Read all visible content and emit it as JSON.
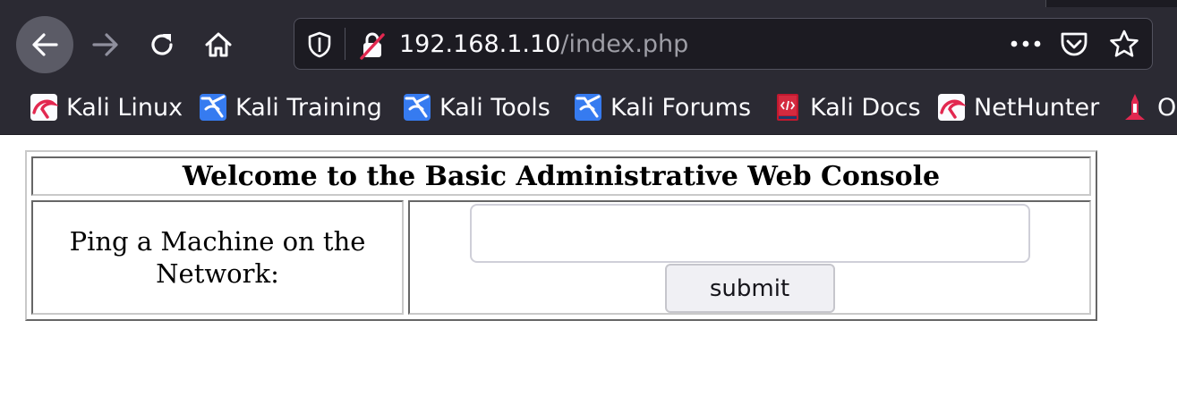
{
  "browser": {
    "url_host": "192.168.1.10",
    "url_path": "/index.php"
  },
  "bookmarks": [
    {
      "label": "Kali Linux",
      "icon": "kali-dragon-icon"
    },
    {
      "label": "Kali Training",
      "icon": "kali-training-icon"
    },
    {
      "label": "Kali Tools",
      "icon": "kali-tools-icon"
    },
    {
      "label": "Kali Forums",
      "icon": "kali-forums-icon"
    },
    {
      "label": "Kali Docs",
      "icon": "kali-docs-icon"
    },
    {
      "label": "NetHunter",
      "icon": "nethunter-icon"
    },
    {
      "label": "O",
      "icon": "offsec-icon"
    }
  ],
  "page": {
    "title": "Welcome to the Basic Administrative Web Console",
    "ping_label": "Ping a Machine on the Network:",
    "ping_value": "",
    "submit_label": "submit"
  },
  "colors": {
    "chrome_bg": "#2b2a33",
    "urlbar_bg": "#1c1b22",
    "accent_red": "#e22850",
    "accent_blue": "#367bf0"
  }
}
